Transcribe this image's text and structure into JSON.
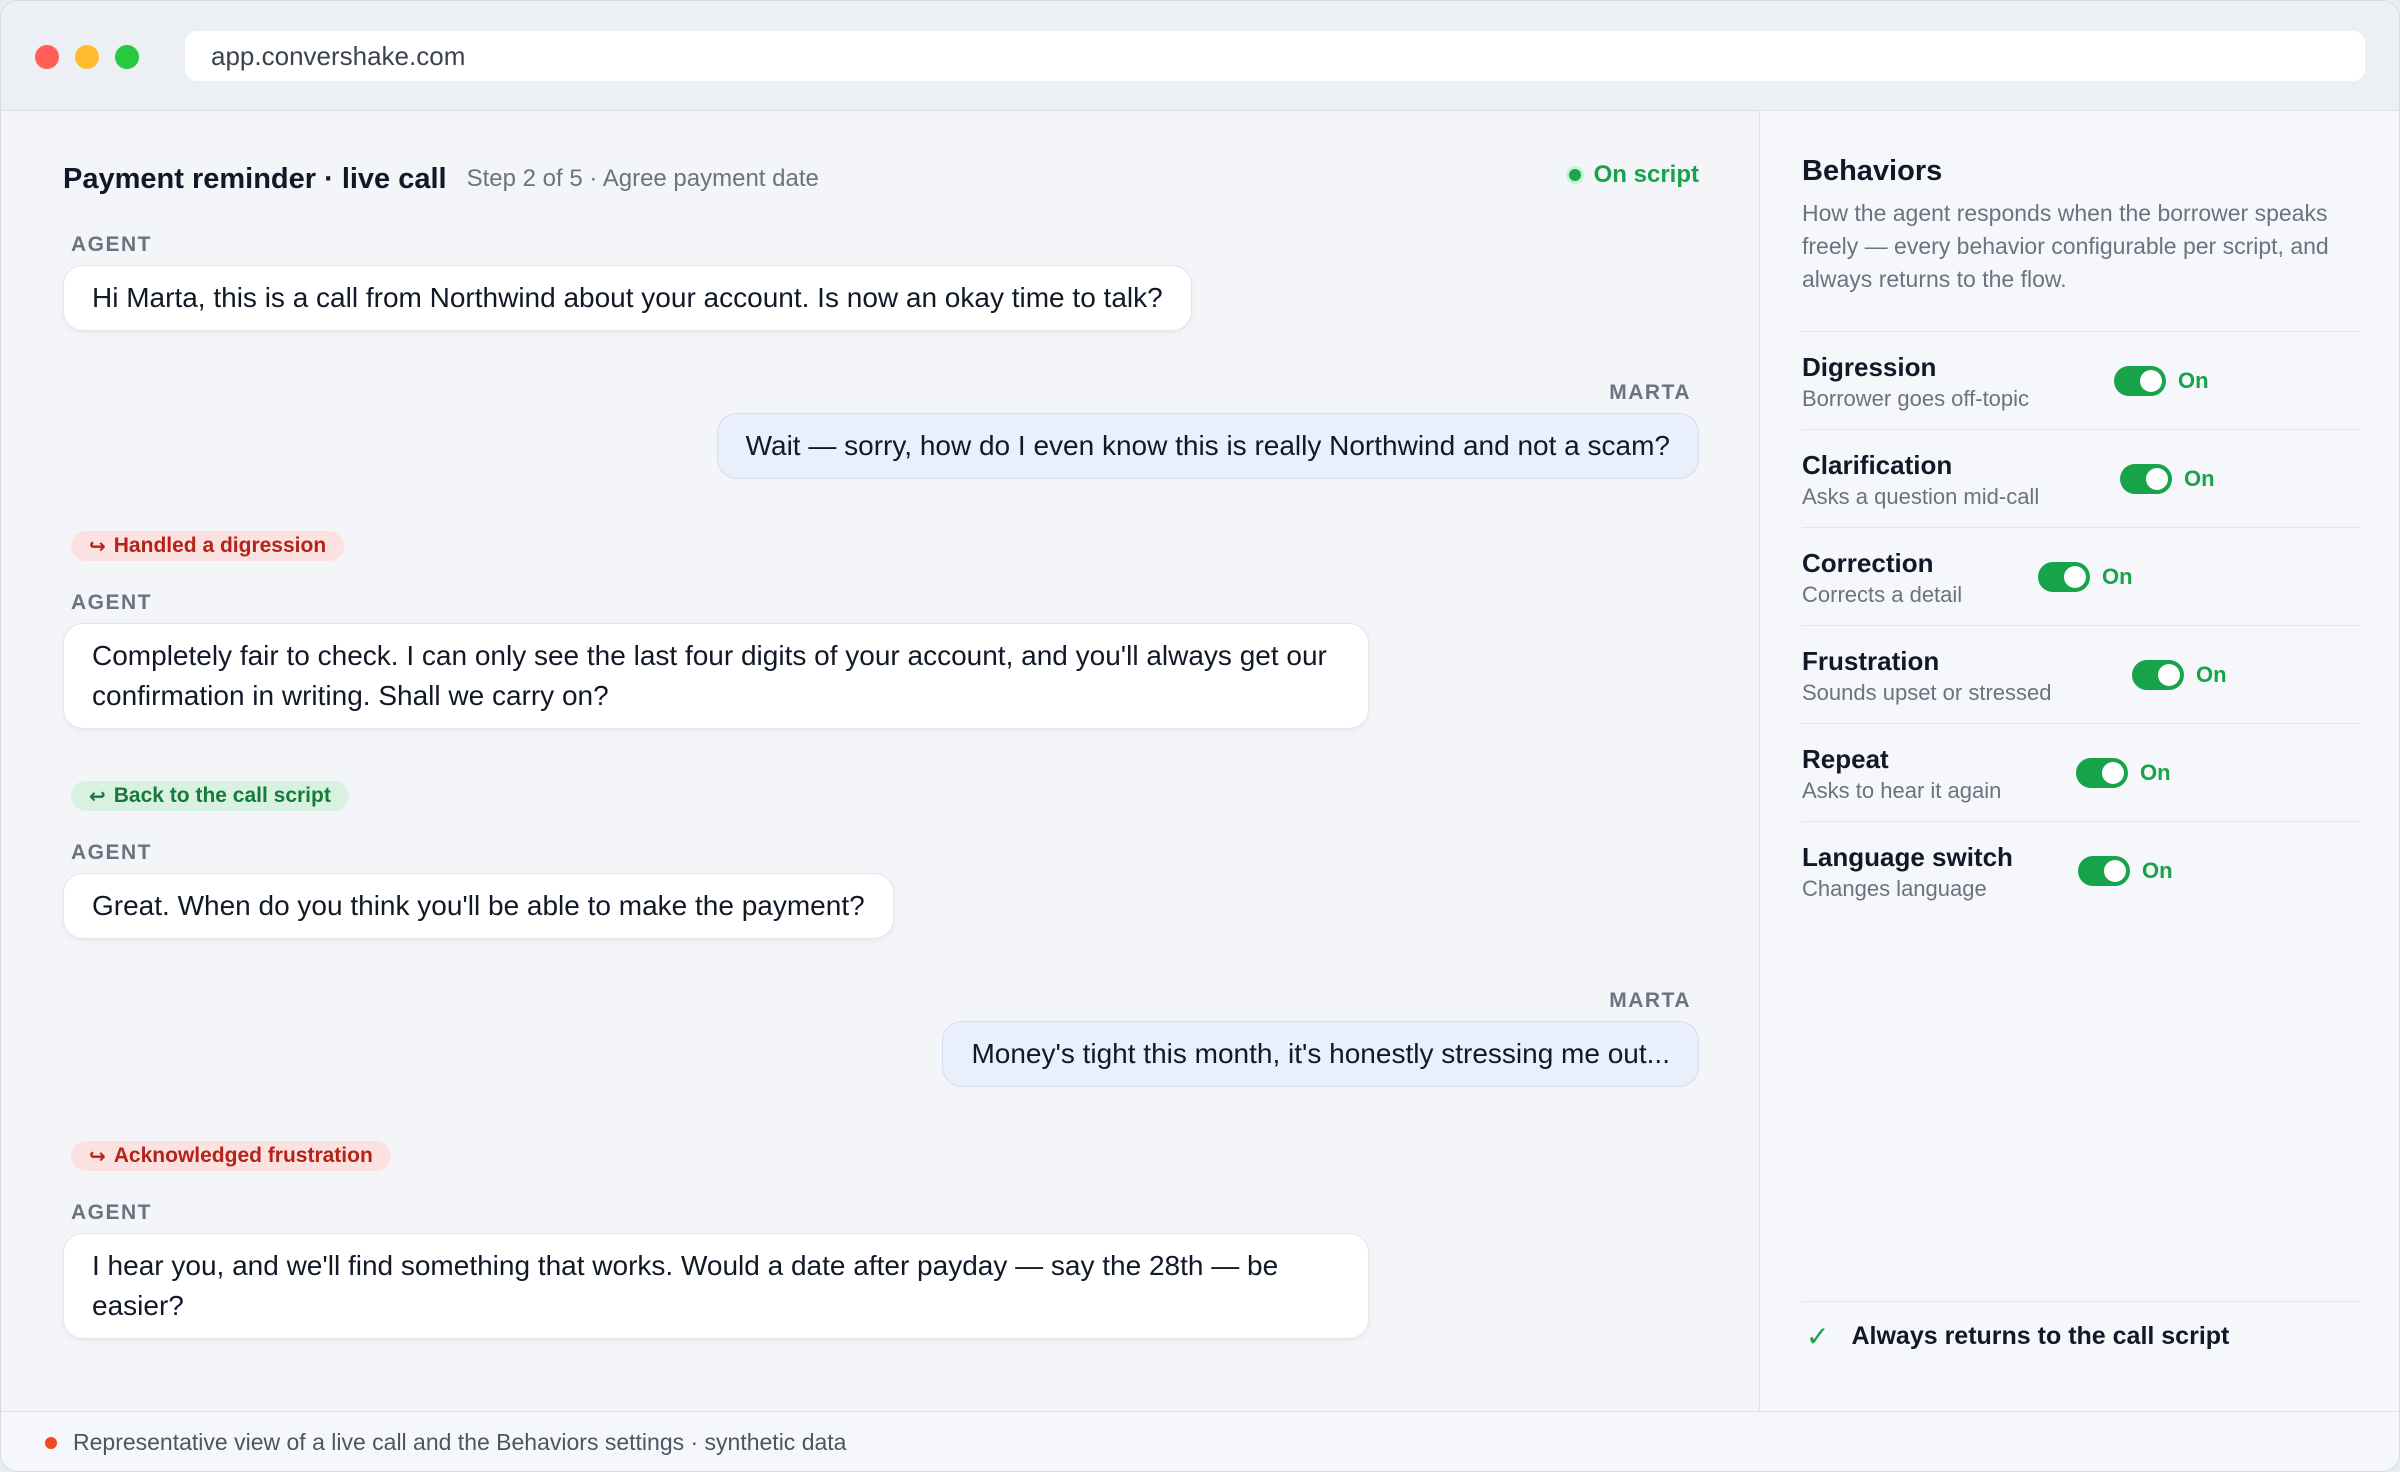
{
  "window": {
    "url": "app.convershake.com"
  },
  "call": {
    "title": "Payment reminder · live call",
    "step": "Step 2 of 5 · Agree payment date",
    "status": "On script"
  },
  "messages": [
    {
      "speaker": "AGENT",
      "text": "Hi Marta, this is a call from Northwind about your account. Is now an okay time to talk?"
    },
    {
      "speaker": "MARTA",
      "text": "Wait — sorry, how do I even know this is really Northwind and not a scam?"
    },
    {
      "speaker": "AGENT",
      "text": "Completely fair to check. I can only see the last four digits of your account, and you'll always get our confirmation in writing. Shall we carry on?"
    },
    {
      "speaker": "AGENT",
      "text": "Great. When do you think you'll be able to make the payment?"
    },
    {
      "speaker": "MARTA",
      "text": "Money's tight this month, it's honestly stressing me out..."
    },
    {
      "speaker": "AGENT",
      "text": "I hear you, and we'll find something that works. Would a date after payday — say the 28th — be easier?"
    }
  ],
  "tags": [
    {
      "label": "Handled a digression",
      "icon": "↪",
      "kind": "digression"
    },
    {
      "label": "Back to the call script",
      "icon": "↩",
      "kind": "return"
    },
    {
      "label": "Acknowledged frustration",
      "icon": "↪",
      "kind": "frustration"
    }
  ],
  "behaviors": {
    "title": "Behaviors",
    "description": "How the agent responds when the borrower speaks freely — every behavior configurable per script, and always returns to the flow.",
    "items": [
      {
        "name": "Digression",
        "sub": "Borrower goes off-topic",
        "state": "On"
      },
      {
        "name": "Clarification",
        "sub": "Asks a question mid-call",
        "state": "On"
      },
      {
        "name": "Correction",
        "sub": "Corrects a detail",
        "state": "On"
      },
      {
        "name": "Frustration",
        "sub": "Sounds upset or stressed",
        "state": "On"
      },
      {
        "name": "Repeat",
        "sub": "Asks to hear it again",
        "state": "On"
      },
      {
        "name": "Language switch",
        "sub": "Changes language",
        "state": "On"
      }
    ],
    "footer": "Always returns to the call script",
    "footer_icon": "✓"
  },
  "footer": {
    "text": "Representative view of a live call and the Behaviors settings · synthetic data"
  },
  "colors": {
    "accent_green": "#16a34a",
    "tag_red_text": "#b42318",
    "tag_red_bg": "#fbe1e0",
    "tag_green_bg": "#d9f1e1",
    "user_bubble": "#e9effb",
    "status_dot_footer": "#ef4b23"
  }
}
